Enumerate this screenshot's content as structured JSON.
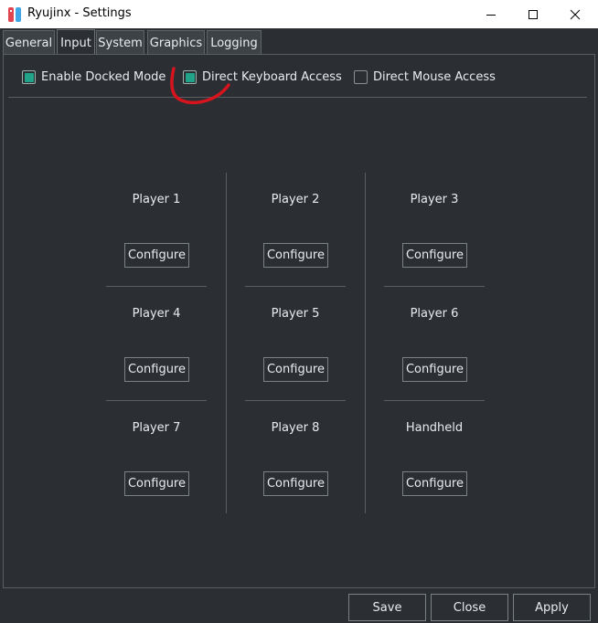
{
  "window": {
    "title": "Ryujinx - Settings",
    "minimize_icon": "minimize-icon",
    "maximize_icon": "maximize-icon",
    "close_icon": "close-icon"
  },
  "tabs": [
    {
      "label": "General",
      "active": false
    },
    {
      "label": "Input",
      "active": true
    },
    {
      "label": "System",
      "active": false
    },
    {
      "label": "Graphics",
      "active": false
    },
    {
      "label": "Logging",
      "active": false
    }
  ],
  "options": {
    "docked_mode": {
      "label": "Enable Docked Mode",
      "checked": true
    },
    "keyboard_access": {
      "label": "Direct Keyboard Access",
      "checked": true
    },
    "mouse_access": {
      "label": "Direct Mouse Access",
      "checked": false
    }
  },
  "players": [
    {
      "label": "Player 1",
      "button": "Configure"
    },
    {
      "label": "Player 2",
      "button": "Configure"
    },
    {
      "label": "Player 3",
      "button": "Configure"
    },
    {
      "label": "Player 4",
      "button": "Configure"
    },
    {
      "label": "Player 5",
      "button": "Configure"
    },
    {
      "label": "Player 6",
      "button": "Configure"
    },
    {
      "label": "Player 7",
      "button": "Configure"
    },
    {
      "label": "Player 8",
      "button": "Configure"
    },
    {
      "label": "Handheld",
      "button": "Configure"
    }
  ],
  "footer": {
    "save": "Save",
    "close": "Close",
    "apply": "Apply"
  },
  "colors": {
    "background": "#2b2f33",
    "accent_checkbox": "#21a38a",
    "annotation": "#d7141e"
  }
}
